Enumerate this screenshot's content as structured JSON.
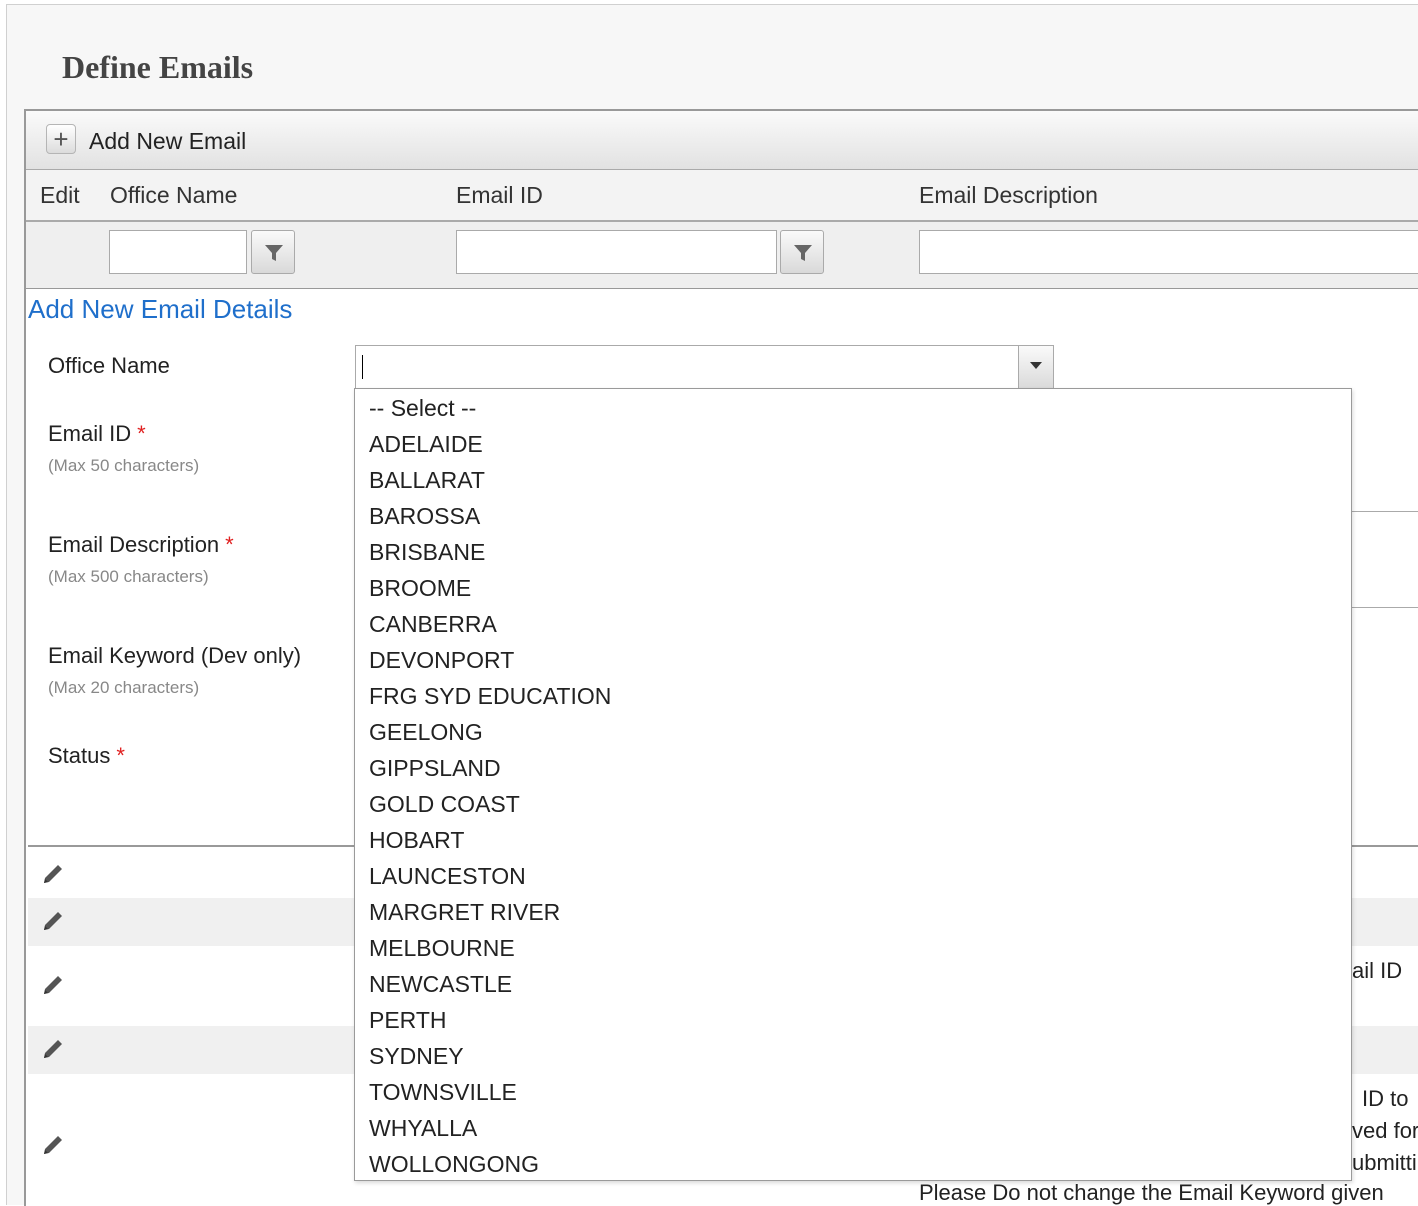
{
  "page": {
    "title": "Define Emails"
  },
  "toolbar": {
    "add_label": "Add New Email"
  },
  "columns": {
    "edit": "Edit",
    "office_name": "Office Name",
    "email_id": "Email ID",
    "email_description": "Email Description"
  },
  "form": {
    "title": "Add New Email Details",
    "office_name_label": "Office Name",
    "email_id_label": "Email ID",
    "email_id_hint": "(Max 50 characters)",
    "email_description_label": "Email Description",
    "email_description_hint": "(Max 500 characters)",
    "email_keyword_label": "Email Keyword (Dev only)",
    "email_keyword_hint": "(Max 20 characters)",
    "status_label": "Status",
    "required_marker": "*"
  },
  "dropdown": {
    "options": [
      "-- Select --",
      "ADELAIDE",
      "BALLARAT",
      "BAROSSA",
      "BRISBANE",
      "BROOME",
      "CANBERRA",
      "DEVONPORT",
      "FRG SYD EDUCATION",
      "GEELONG",
      "GIPPSLAND",
      "GOLD COAST",
      "HOBART",
      "LAUNCESTON",
      "MARGRET RIVER",
      "MELBOURNE",
      "NEWCASTLE",
      "PERTH",
      "SYDNEY",
      "TOWNSVILLE",
      "WHYALLA",
      "WOLLONGONG"
    ]
  },
  "rows": {
    "partial_1": "ail ID",
    "partial_2": "ID to",
    "partial_3": "ved for",
    "partial_4": "ubmitti",
    "partial_5": "Please Do not change the Email Keyword given"
  }
}
